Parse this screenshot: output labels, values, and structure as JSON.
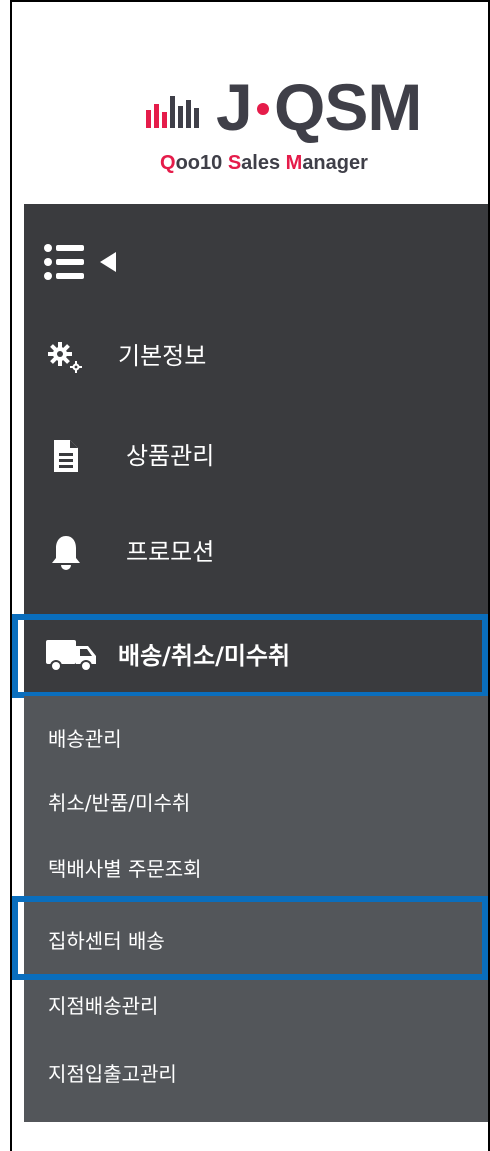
{
  "logo": {
    "letter_j": "J",
    "letters_qsm": "QSM",
    "subtitle_parts": [
      "Q",
      "oo10 ",
      "S",
      "ales ",
      "M",
      "anager"
    ],
    "brand_red": "#e51c4a",
    "brand_dark": "#3f3f48"
  },
  "sidebar": {
    "toggle_icon": "list-collapse-icon",
    "items": [
      {
        "label": "기본정보",
        "icon": "gears-icon"
      },
      {
        "label": "상품관리",
        "icon": "document-icon"
      },
      {
        "label": "프로모션",
        "icon": "bell-icon"
      },
      {
        "label": "배송/취소/미수취",
        "icon": "truck-icon",
        "active": true
      }
    ],
    "sub_items": [
      {
        "label": "배송관리"
      },
      {
        "label": "취소/반품/미수취"
      },
      {
        "label": "택배사별 주문조회"
      },
      {
        "label": "집하센터 배송",
        "highlighted": true
      },
      {
        "label": "지점배송관리"
      },
      {
        "label": "지점입출고관리"
      }
    ]
  },
  "colors": {
    "sidebar_dark": "#3a3b3e",
    "submenu_bg": "#53565a",
    "highlight": "#0a6ebd"
  }
}
